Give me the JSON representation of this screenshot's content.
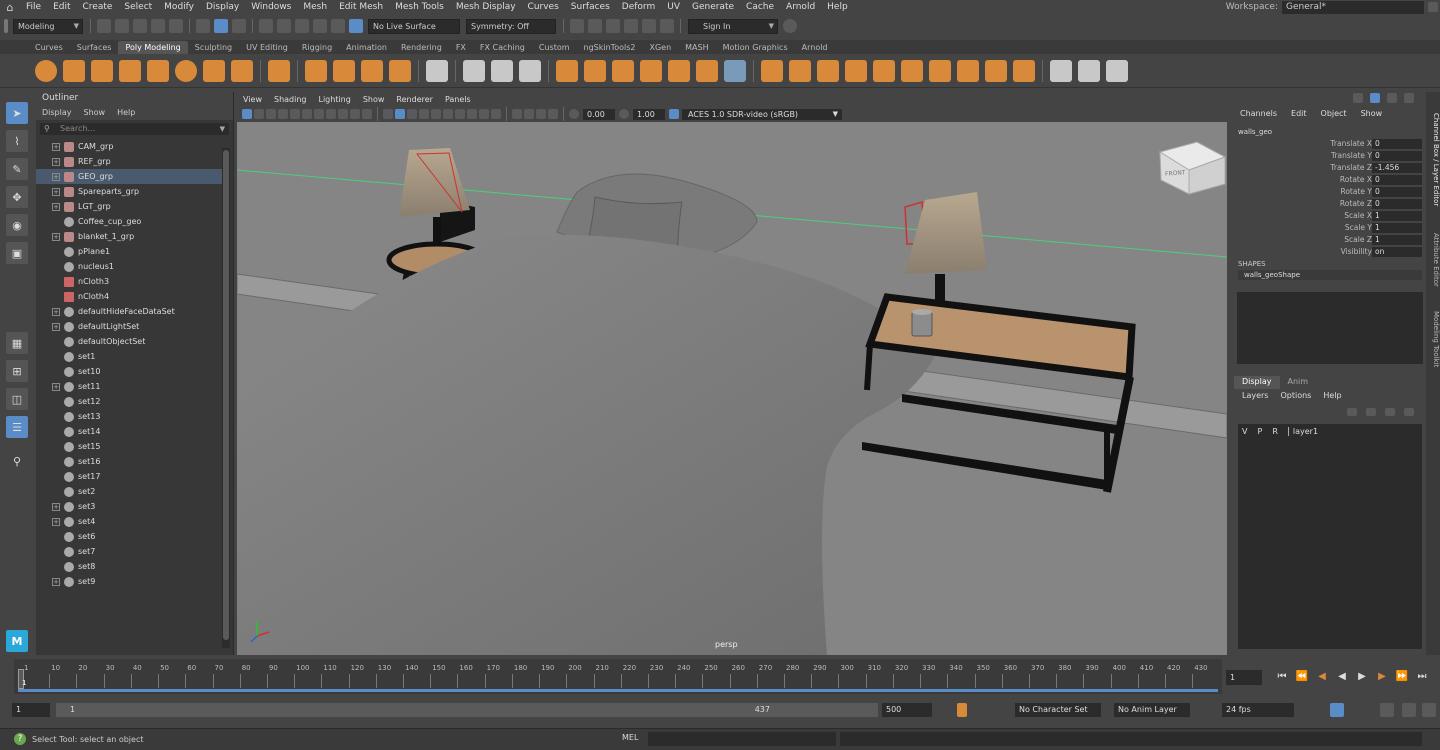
{
  "menubar": {
    "items": [
      "File",
      "Edit",
      "Create",
      "Select",
      "Modify",
      "Display",
      "Windows",
      "Mesh",
      "Edit Mesh",
      "Mesh Tools",
      "Mesh Display",
      "Curves",
      "Surfaces",
      "Deform",
      "UV",
      "Generate",
      "Cache",
      "Arnold",
      "Help"
    ],
    "workspace_label": "Workspace:",
    "workspace_value": "General*"
  },
  "statusline": {
    "mode": "Modeling",
    "live_surface": "No Live Surface",
    "symmetry": "Symmetry: Off",
    "sign_in": "Sign In"
  },
  "shelf": {
    "tabs": [
      "Curves",
      "Surfaces",
      "Poly Modeling",
      "Sculpting",
      "UV Editing",
      "Rigging",
      "Animation",
      "Rendering",
      "FX",
      "FX Caching",
      "Custom",
      "ngSkinTools2",
      "XGen",
      "MASH",
      "Motion Graphics",
      "Arnold"
    ],
    "active_tab": "Poly Modeling"
  },
  "outliner": {
    "title": "Outliner",
    "menu": [
      "Display",
      "Show",
      "Help"
    ],
    "search_placeholder": "Search...",
    "items": [
      {
        "name": "CAM_grp",
        "type": "grp",
        "expand": true
      },
      {
        "name": "REF_grp",
        "type": "grp",
        "expand": true
      },
      {
        "name": "GEO_grp",
        "type": "grp",
        "expand": true,
        "selected": true
      },
      {
        "name": "Spareparts_grp",
        "type": "grp",
        "expand": true
      },
      {
        "name": "LGT_grp",
        "type": "grp",
        "expand": true
      },
      {
        "name": "Coffee_cup_geo",
        "type": "mesh",
        "expand": false
      },
      {
        "name": "blanket_1_grp",
        "type": "grp",
        "expand": true
      },
      {
        "name": "pPlane1",
        "type": "mesh",
        "expand": false
      },
      {
        "name": "nucleus1",
        "type": "node",
        "expand": false
      },
      {
        "name": "nCloth3",
        "type": "cloth",
        "expand": false
      },
      {
        "name": "nCloth4",
        "type": "cloth",
        "expand": false
      },
      {
        "name": "defaultHideFaceDataSet",
        "type": "set",
        "expand": true
      },
      {
        "name": "defaultLightSet",
        "type": "set",
        "expand": true
      },
      {
        "name": "defaultObjectSet",
        "type": "set",
        "expand": false
      },
      {
        "name": "set1",
        "type": "set",
        "expand": false
      },
      {
        "name": "set10",
        "type": "set",
        "expand": false
      },
      {
        "name": "set11",
        "type": "set",
        "expand": true
      },
      {
        "name": "set12",
        "type": "set",
        "expand": false
      },
      {
        "name": "set13",
        "type": "set",
        "expand": false
      },
      {
        "name": "set14",
        "type": "set",
        "expand": false
      },
      {
        "name": "set15",
        "type": "set",
        "expand": false
      },
      {
        "name": "set16",
        "type": "set",
        "expand": false
      },
      {
        "name": "set17",
        "type": "set",
        "expand": false
      },
      {
        "name": "set2",
        "type": "set",
        "expand": false
      },
      {
        "name": "set3",
        "type": "set",
        "expand": true
      },
      {
        "name": "set4",
        "type": "set",
        "expand": true
      },
      {
        "name": "set6",
        "type": "set",
        "expand": false
      },
      {
        "name": "set7",
        "type": "set",
        "expand": false
      },
      {
        "name": "set8",
        "type": "set",
        "expand": false
      },
      {
        "name": "set9",
        "type": "set",
        "expand": true
      }
    ]
  },
  "viewport": {
    "menu": [
      "View",
      "Shading",
      "Lighting",
      "Show",
      "Renderer",
      "Panels"
    ],
    "exposure": "0.00",
    "gamma": "1.00",
    "colorspace": "ACES 1.0 SDR-video (sRGB)",
    "camera_label": "persp",
    "viewcube_label": "FRONT"
  },
  "channelbox": {
    "menu": [
      "Channels",
      "Edit",
      "Object",
      "Show"
    ],
    "object": "walls_geo",
    "attrs": [
      {
        "name": "Translate X",
        "value": "0"
      },
      {
        "name": "Translate Y",
        "value": "0"
      },
      {
        "name": "Translate Z",
        "value": "-1.456"
      },
      {
        "name": "Rotate X",
        "value": "0"
      },
      {
        "name": "Rotate Y",
        "value": "0"
      },
      {
        "name": "Rotate Z",
        "value": "0"
      },
      {
        "name": "Scale X",
        "value": "1"
      },
      {
        "name": "Scale Y",
        "value": "1"
      },
      {
        "name": "Scale Z",
        "value": "1"
      },
      {
        "name": "Visibility",
        "value": "on"
      }
    ],
    "shapes_label": "SHAPES",
    "shape_name": "walls_geoShape"
  },
  "layereditor": {
    "tabs": [
      "Display",
      "Anim"
    ],
    "active_tab": "Display",
    "menu": [
      "Layers",
      "Options",
      "Help"
    ],
    "layer": {
      "v": "V",
      "p": "P",
      "r": "R",
      "name": "layer1"
    }
  },
  "sidetabs": [
    "Channel Box / Layer Editor",
    "Attribute Editor",
    "Modeling Toolkit"
  ],
  "timeslider": {
    "ticks": [
      "1",
      "10",
      "20",
      "30",
      "40",
      "50",
      "60",
      "70",
      "80",
      "90",
      "100",
      "110",
      "120",
      "130",
      "140",
      "150",
      "160",
      "170",
      "180",
      "190",
      "200",
      "210",
      "220",
      "230",
      "240",
      "250",
      "260",
      "270",
      "280",
      "290",
      "300",
      "310",
      "320",
      "330",
      "340",
      "350",
      "360",
      "370",
      "380",
      "390",
      "400",
      "410",
      "420",
      "430"
    ],
    "current_frame": "1"
  },
  "range": {
    "start": "1",
    "inner_start": "1",
    "inner_end": "437",
    "end": "500",
    "char_set": "No Character Set",
    "anim_layer": "No Anim Layer",
    "fps": "24 fps"
  },
  "commandline": {
    "help": "Select Tool: select an object",
    "mel": "MEL"
  },
  "colors": {
    "accent": "#5a8cc8",
    "shelf_orange": "#d8893a",
    "selected_row": "#4a5a6e"
  }
}
